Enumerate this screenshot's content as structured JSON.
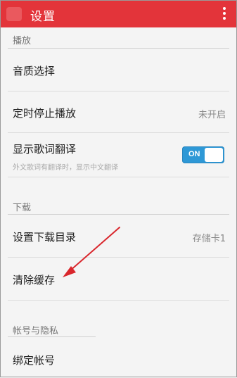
{
  "appbar": {
    "title": "设置"
  },
  "sections": {
    "playback": "播放",
    "download": "下载",
    "account": "帐号与隐私"
  },
  "rows": {
    "quality": {
      "label": "音质选择"
    },
    "timer": {
      "label": "定时停止播放",
      "value": "未开启"
    },
    "lyrics": {
      "label": "显示歌词翻译",
      "sub": "外文歌词有翻译时，显示中文翻译",
      "toggle": "ON",
      "enabled": true
    },
    "download_dir": {
      "label": "设置下载目录",
      "value": "存储卡1"
    },
    "clear_cache": {
      "label": "清除缓存"
    },
    "bind_account": {
      "label": "绑定帐号"
    }
  },
  "colors": {
    "appbar": "#e3343a",
    "toggle_on": "#2e98d6",
    "annotation_arrow": "#d9262c"
  }
}
